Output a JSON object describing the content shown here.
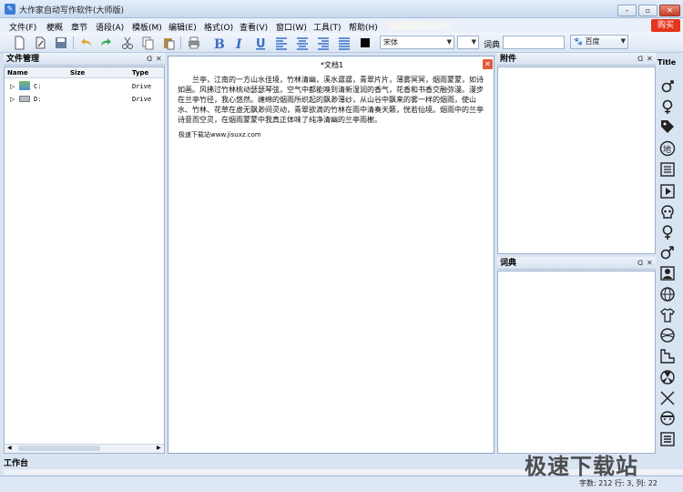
{
  "window": {
    "title": "大作家自动写作软件(大师版)"
  },
  "menu": [
    "文件(F)",
    "梗概",
    "章节",
    "语段(A)",
    "模板(M)",
    "编辑(E)",
    "格式(O)",
    "查看(V)",
    "窗口(W)",
    "工具(T)",
    "帮助(H)"
  ],
  "buy_label": "购买",
  "toolbar": {
    "font_name": "宋体",
    "font_size": "",
    "dict_label": "词典",
    "dict_input": "",
    "search_engine": "百度"
  },
  "file_panel": {
    "title": "文件管理",
    "columns": [
      "Name",
      "Size",
      "Type"
    ],
    "rows": [
      {
        "name": "C:",
        "type": "Drive"
      },
      {
        "name": "D:",
        "type": "Drive"
      }
    ]
  },
  "document": {
    "tab_title": "*文档1",
    "body": "兰亭，江南的一方山水佳境，竹林清幽，溪水潺潺，青翠片片，薄雾冥冥，烟雨蒙蒙，如诗如画。风拂过竹林桃动瑟瑟琴弦，空气中都能嗅到清新湿润的香气，花香和书香交融弥漫。漫步在兰亭竹径，我心悠然。缠绵的烟雨所织起的飘渺薄纱，从山谷中飘来的雾一样的烟雨，使山水、竹林、花草在虚无飘渺间灵动，青翠欲滴的竹林在雨中清奏天籁，恍若仙境。烟雨中的兰亭诗意而空灵，在烟雨蒙蒙中我真正体味了纯净清幽的兰亭雨榭。",
    "link_line": "极速下载站www.jisuxz.com"
  },
  "attachments_panel": {
    "title": "附件"
  },
  "dict_panel": {
    "title": "词典"
  },
  "side_label": "Title",
  "workbench": {
    "title": "工作台"
  },
  "status": {
    "text": "字数: 212 行: 3, 列: 22"
  },
  "watermark": "极速下载站",
  "colors": {
    "accent": "#3d7bd6",
    "buy": "#e3361c",
    "close": "#c63d25"
  }
}
